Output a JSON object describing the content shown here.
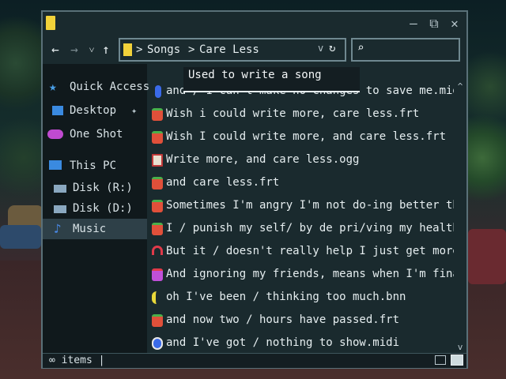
{
  "window": {
    "minimize_glyph": "—",
    "maximize_glyph": "⧉",
    "close_glyph": "✕"
  },
  "nav": {
    "back_glyph": "←",
    "forward_glyph": "→",
    "recent_glyph": "˅",
    "up_glyph": "↑"
  },
  "address": {
    "crumbs": [
      "Songs",
      "Care Less"
    ],
    "separator": ">",
    "dropdown_glyph": "v",
    "refresh_glyph": "↻"
  },
  "search": {
    "icon_glyph": "⌕"
  },
  "tooltip": {
    "text": "Used to write a song"
  },
  "sidebar": {
    "items": [
      {
        "label": "Quick Access",
        "icon": "star-icon",
        "color": "#4aa0e8",
        "pinned": false
      },
      {
        "label": "Desktop",
        "icon": "desktop-icon",
        "color": "#3a8ae0",
        "pinned": true
      },
      {
        "label": "One Shot",
        "icon": "cloud-icon",
        "color": "#c04ad0",
        "pinned": false
      },
      {
        "label": "This PC",
        "icon": "monitor-icon",
        "color": "#3a8ae0",
        "pinned": false
      },
      {
        "label": "Disk (R:)",
        "icon": "disk-icon",
        "color": "#8aa8c0",
        "pinned": false
      },
      {
        "label": "Disk (D:)",
        "icon": "disk-icon",
        "color": "#8aa8c0",
        "pinned": false
      },
      {
        "label": "Music",
        "icon": "music-note-icon",
        "color": "#4a8ae8",
        "pinned": false
      }
    ],
    "pin_glyph": "✦"
  },
  "files": [
    {
      "name": "and / I can't make no changes to save me.midi",
      "icon": "midi-icon",
      "color": "#3a6ae8"
    },
    {
      "name": "Wish i could write more, care less.frt",
      "icon": "strawberry-icon",
      "color": "#e0503a"
    },
    {
      "name": "Wish I could write more, and care less.frt",
      "icon": "strawberry-icon",
      "color": "#e0503a"
    },
    {
      "name": "Write more, and care less.ogg",
      "icon": "card-icon",
      "color": "#e8e0d0"
    },
    {
      "name": "and care less.frt",
      "icon": "strawberry-icon",
      "color": "#e0503a"
    },
    {
      "name": "Sometimes I'm angry I'm not do-ing better than",
      "icon": "strawberry-icon",
      "color": "#e0503a"
    },
    {
      "name": "I / punish my self/ by de pri/ving my health/",
      "icon": "strawberry-icon",
      "color": "#e0503a"
    },
    {
      "name": "But it / doesn't really help I just get more de",
      "icon": "headphones-icon",
      "color": "#e03a4a"
    },
    {
      "name": "And ignoring my friends, means when I'm finally",
      "icon": "jar-icon",
      "color": "#c050d8"
    },
    {
      "name": "oh I've been / thinking too much.bnn",
      "icon": "banana-icon",
      "color": "#e8d83a"
    },
    {
      "name": "and now two / hours have passed.frt",
      "icon": "strawberry-icon",
      "color": "#e0503a"
    },
    {
      "name": "and I've got / nothing to show.midi",
      "icon": "midi-icon",
      "color": "#3a6ae8"
    }
  ],
  "scrollbar": {
    "up_glyph": "^",
    "down_glyph": "v"
  },
  "status": {
    "text": "∞ items  |"
  }
}
